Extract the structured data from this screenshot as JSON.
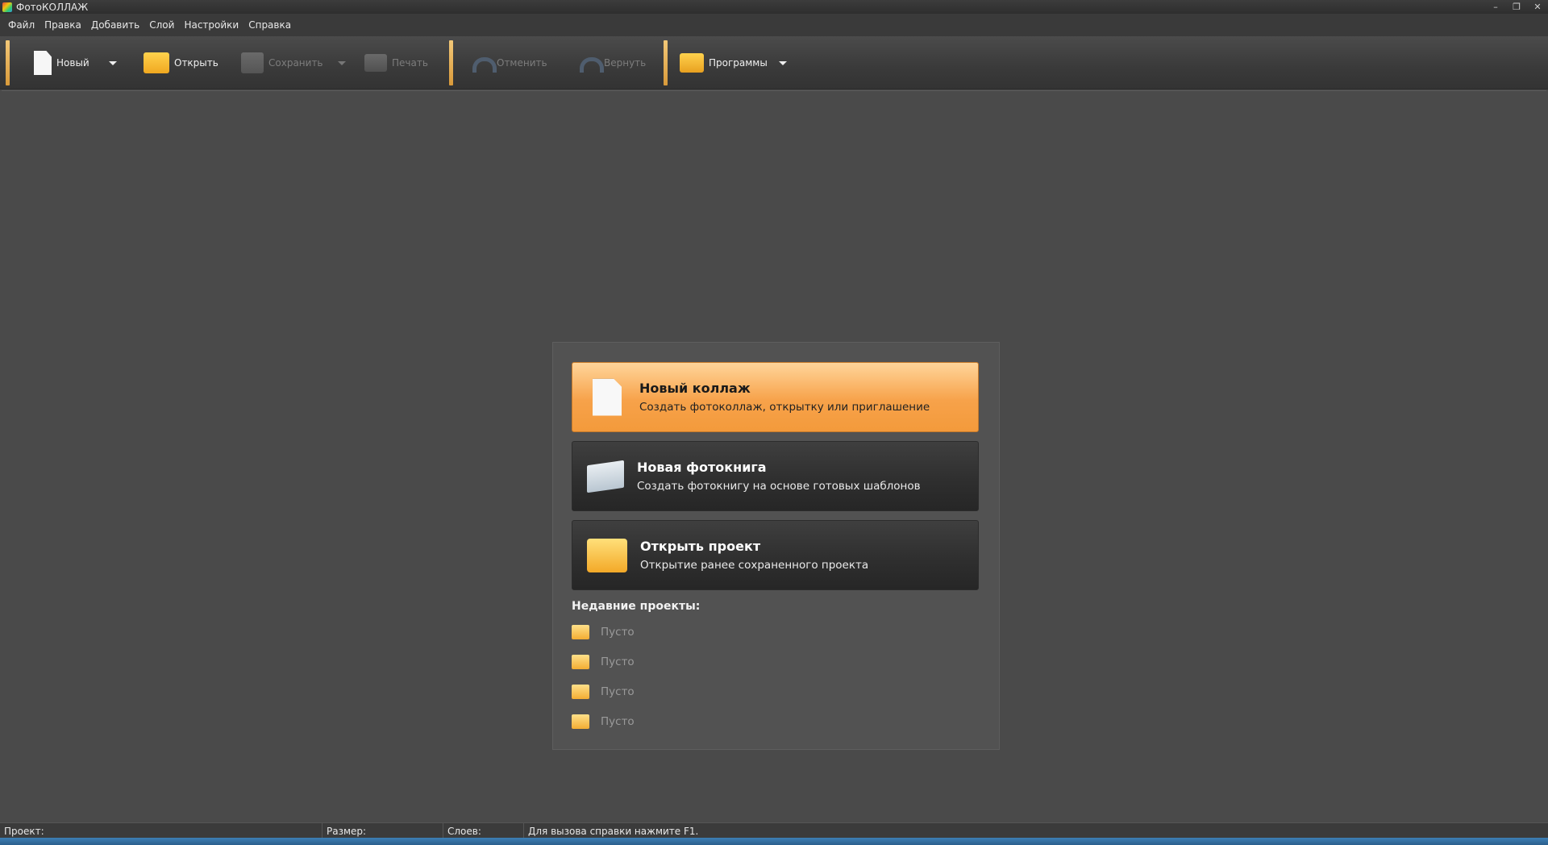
{
  "window": {
    "title": "ФотоКОЛЛАЖ",
    "minimize": "–",
    "restore": "❐",
    "close": "✕"
  },
  "menu": [
    "Файл",
    "Правка",
    "Добавить",
    "Слой",
    "Настройки",
    "Справка"
  ],
  "toolbar": {
    "new_label": "Новый",
    "open_label": "Открыть",
    "save_label": "Сохранить",
    "print_label": "Печать",
    "undo_label": "Отменить",
    "redo_label": "Вернуть",
    "programs_label": "Программы"
  },
  "start": {
    "new_collage_title": "Новый коллаж",
    "new_collage_sub": "Создать фотоколлаж, открытку или приглашение",
    "new_book_title": "Новая фотокнига",
    "new_book_sub": "Создать фотокнигу на основе готовых шаблонов",
    "open_project_title": "Открыть проект",
    "open_project_sub": "Открытие ранее сохраненного проекта",
    "recent_title": "Недавние проекты:",
    "recent": [
      "Пусто",
      "Пусто",
      "Пусто",
      "Пусто"
    ]
  },
  "status": {
    "project": "Проект:",
    "size": "Размер:",
    "layers": "Слоев:",
    "hint": "Для вызова справки нажмите F1."
  },
  "colors": {
    "accent": "#f7a24a",
    "separator": "#f3c878"
  }
}
